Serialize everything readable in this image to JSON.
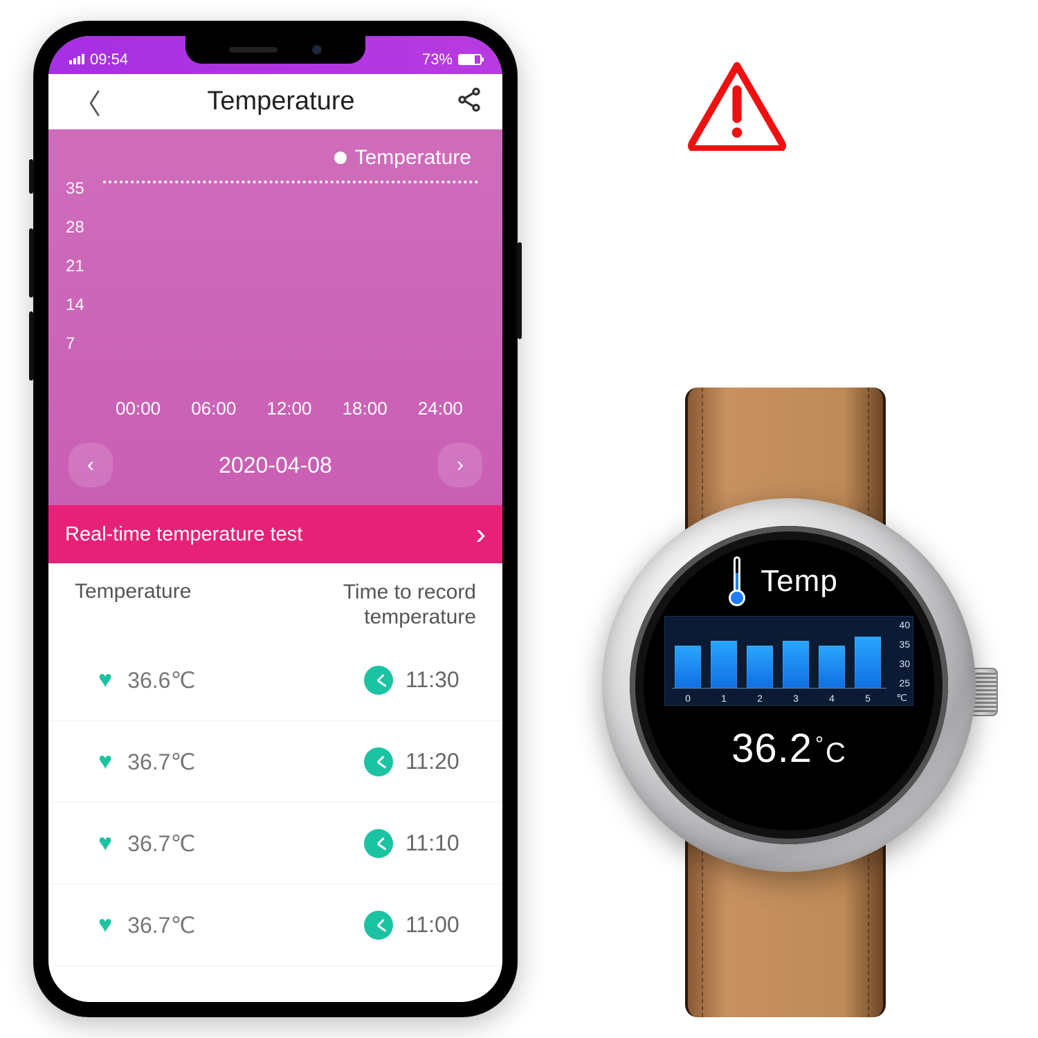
{
  "statusbar": {
    "time": "09:54",
    "battery_pct": "73%"
  },
  "navbar": {
    "title": "Temperature"
  },
  "chart": {
    "legend_label": "Temperature",
    "y_ticks": [
      "35",
      "28",
      "21",
      "14",
      "7"
    ],
    "x_ticks": [
      "00:00",
      "06:00",
      "12:00",
      "18:00",
      "24:00"
    ],
    "date": "2020-04-08"
  },
  "cta": {
    "label": "Real-time temperature test"
  },
  "table": {
    "col1": "Temperature",
    "col2_line1": "Time to record",
    "col2_line2": "temperature",
    "rows": [
      {
        "temp": "36.6℃",
        "time": "11:30"
      },
      {
        "temp": "36.7℃",
        "time": "11:20"
      },
      {
        "temp": "36.7℃",
        "time": "11:10"
      },
      {
        "temp": "36.7℃",
        "time": "11:00"
      }
    ]
  },
  "watch": {
    "title": "Temp",
    "value": "36.2",
    "unit": "℃",
    "x_ticks": [
      "0",
      "1",
      "2",
      "3",
      "4",
      "5"
    ],
    "x_unit": "℃",
    "y_ticks": [
      "40",
      "35",
      "30",
      "25"
    ]
  },
  "chart_data": [
    {
      "type": "line",
      "location": "phone",
      "title": "Temperature",
      "x": [
        "00:00",
        "06:00",
        "12:00",
        "18:00",
        "24:00"
      ],
      "series": [
        {
          "name": "Temperature",
          "value_approx": 35,
          "note": "dotted line at ~35 across 24h"
        }
      ],
      "ylim": [
        0,
        35
      ],
      "y_ticks": [
        7,
        14,
        21,
        28,
        35
      ],
      "date": "2020-04-08"
    },
    {
      "type": "bar",
      "location": "watch",
      "title": "Temp",
      "categories": [
        0,
        1,
        2,
        3,
        4,
        5
      ],
      "values": [
        35,
        36,
        35,
        36,
        35,
        37
      ],
      "ylim": [
        25,
        40
      ],
      "y_ticks": [
        25,
        30,
        35,
        40
      ],
      "x_unit": "℃",
      "current_value": 36.2,
      "unit": "℃"
    }
  ]
}
